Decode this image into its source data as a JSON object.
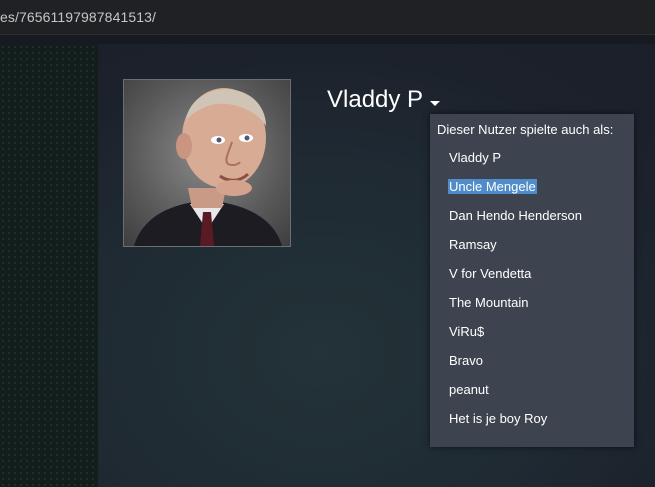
{
  "browser": {
    "url": "es/76561197987841513/"
  },
  "profile": {
    "persona_name": "Vladdy P",
    "aliases": {
      "header": "Dieser Nutzer spielte auch als:",
      "items": [
        {
          "label": "Vladdy P",
          "selected": false
        },
        {
          "label": "Uncle Mengele",
          "selected": true
        },
        {
          "label": "Dan Hendo Henderson",
          "selected": false
        },
        {
          "label": "Ramsay",
          "selected": false
        },
        {
          "label": "V for Vendetta",
          "selected": false
        },
        {
          "label": "The Mountain",
          "selected": false
        },
        {
          "label": "ViRu$",
          "selected": false
        },
        {
          "label": "Bravo",
          "selected": false
        },
        {
          "label": "peanut",
          "selected": false
        },
        {
          "label": "Het is je boy Roy",
          "selected": false
        }
      ]
    }
  },
  "colors": {
    "menu_bg": "#3d4450",
    "selection": "#4f8cc9",
    "page_bg": "#1b2029"
  },
  "icons": {
    "persona_dropdown": "caret-down-icon"
  }
}
